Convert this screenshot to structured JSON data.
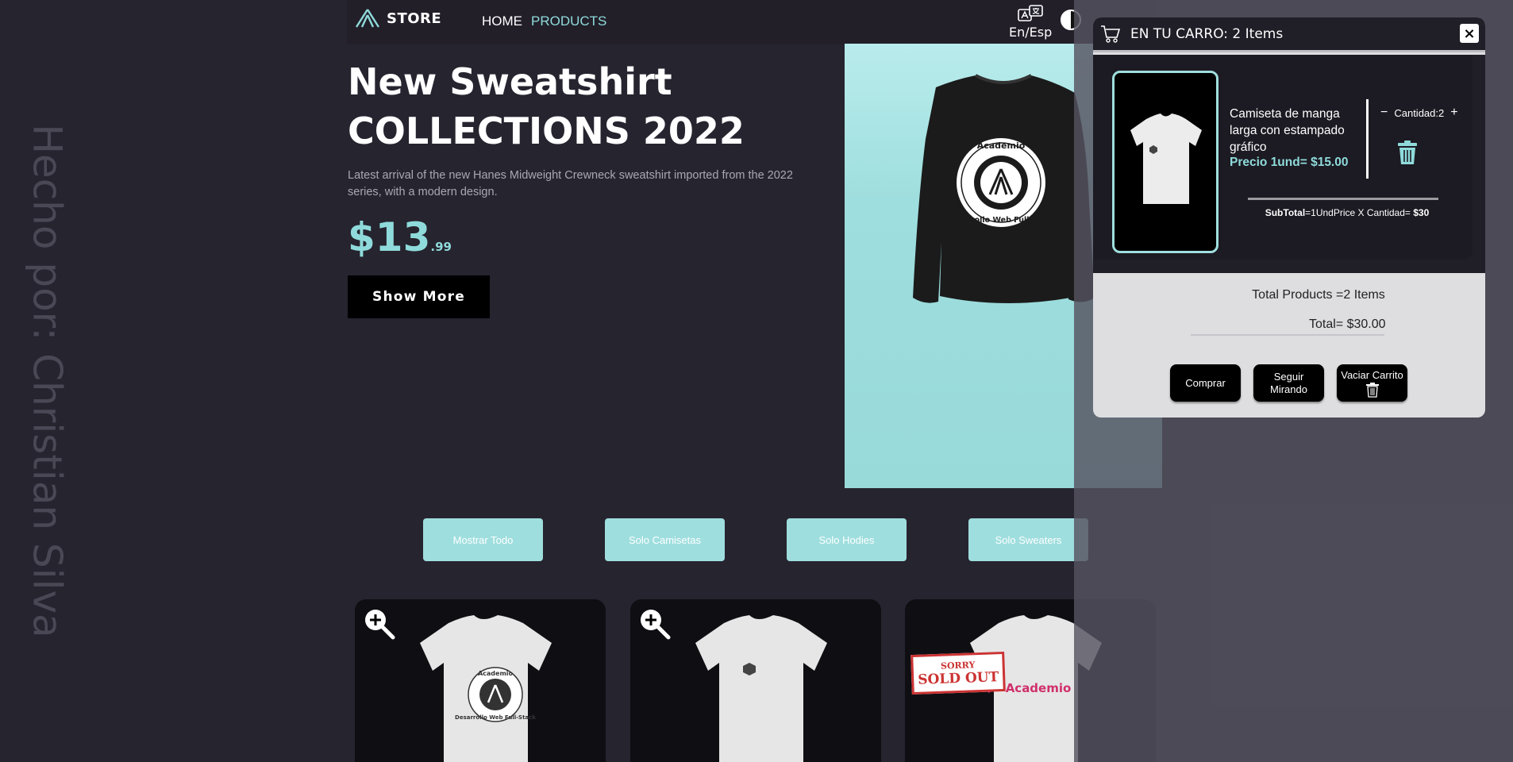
{
  "side_credit": "Hecho por: Christian Silva",
  "nav": {
    "brand": "STORE",
    "links": [
      "HOME",
      "PRODUCTS"
    ],
    "lang_label": "En/Esp"
  },
  "hero": {
    "title_line1": "New Sweatshirt",
    "title_line2": "COLLECTIONS 2022",
    "description": "Latest arrival of the new Hanes Midweight Crewneck sweatshirt imported from the 2022 series, with a modern design.",
    "price_main": "$13",
    "price_cents": ".99",
    "cta": "Show More",
    "image_print_top": "Academio",
    "image_print_bottom": "Desarrollo Web Full-Stack"
  },
  "filters": [
    "Mostrar Todo",
    "Solo Camisetas",
    "Solo Hodies",
    "Solo Sweaters"
  ],
  "products": [
    {
      "print_top": "Academio",
      "print_bottom": "Desarrollo Web Full-Stack"
    },
    {},
    {
      "badge_top": "SORRY",
      "badge_bottom": "SOLD OUT",
      "print_text": "Academio"
    }
  ],
  "cart": {
    "title": "EN TU CARRO: 2 Items",
    "close": "×",
    "item": {
      "name": "Camiseta de manga larga con estampado gráfico",
      "price": "Precio 1und= $15.00",
      "qty_minus": "−",
      "qty_label": "Cantidad:2",
      "qty_plus": "+",
      "subtotal_bold": "SubTotal",
      "subtotal_mid": "=1UndPrice X Cantidad= ",
      "subtotal_value": "$30"
    },
    "total_products": "Total Products =2 Items",
    "total": "Total= $30.00",
    "buttons": {
      "buy": "Comprar",
      "keep_line1": "Seguir",
      "keep_line2": "Mirando",
      "empty": "Vaciar Carrito"
    }
  },
  "colors": {
    "background": "#26242f",
    "accent": "#8fdbdb",
    "hero_panel": "#9fdede",
    "cart_light": "#dedee0"
  }
}
